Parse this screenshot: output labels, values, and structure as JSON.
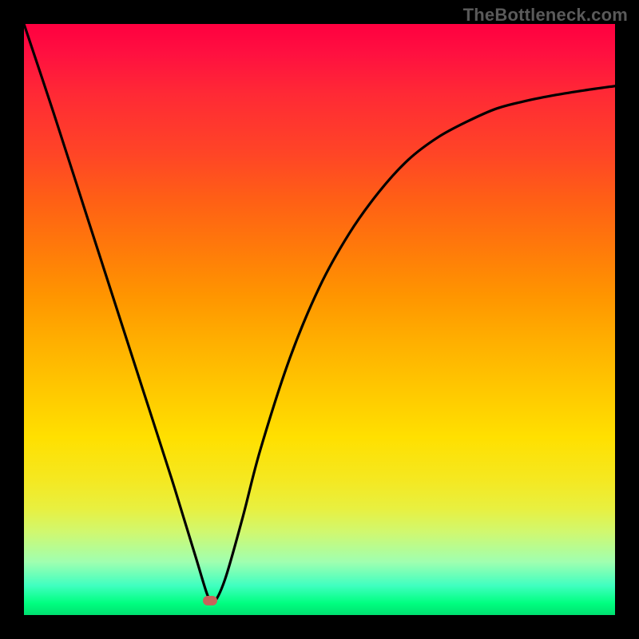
{
  "watermark_text": "TheBottleneck.com",
  "marker": {
    "x_frac": 0.315,
    "y_frac": 0.975
  },
  "chart_data": {
    "type": "line",
    "title": "",
    "xlabel": "",
    "ylabel": "",
    "xlim": [
      0,
      1
    ],
    "ylim": [
      0,
      1
    ],
    "background_gradient": {
      "orientation": "vertical",
      "stops": [
        {
          "pos": 0.0,
          "color": "#ff0040"
        },
        {
          "pos": 0.3,
          "color": "#ff6015"
        },
        {
          "pos": 0.55,
          "color": "#ffb000"
        },
        {
          "pos": 0.75,
          "color": "#ffe000"
        },
        {
          "pos": 0.9,
          "color": "#a0ffb0"
        },
        {
          "pos": 1.0,
          "color": "#00e070"
        }
      ]
    },
    "series": [
      {
        "name": "bottleneck-curve",
        "x": [
          0.0,
          0.05,
          0.1,
          0.15,
          0.2,
          0.25,
          0.29,
          0.31,
          0.32,
          0.34,
          0.37,
          0.4,
          0.45,
          0.5,
          0.55,
          0.6,
          0.65,
          0.7,
          0.75,
          0.8,
          0.85,
          0.9,
          0.95,
          1.0
        ],
        "y": [
          1.0,
          0.85,
          0.695,
          0.54,
          0.385,
          0.23,
          0.1,
          0.035,
          0.02,
          0.06,
          0.165,
          0.28,
          0.435,
          0.555,
          0.645,
          0.715,
          0.77,
          0.808,
          0.835,
          0.857,
          0.87,
          0.88,
          0.888,
          0.895
        ]
      }
    ],
    "annotations": [
      {
        "type": "marker",
        "shape": "rounded-rect",
        "x": 0.315,
        "y": 0.025,
        "color": "#c8635a"
      }
    ]
  }
}
